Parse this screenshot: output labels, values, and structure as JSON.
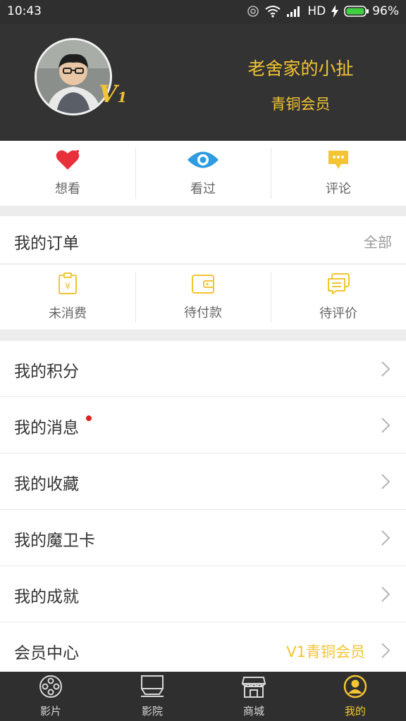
{
  "status_bar": {
    "time": "10:43",
    "network": "HD",
    "battery": "96%"
  },
  "profile": {
    "username": "老舍家的小扯",
    "level": "青铜会员",
    "badge_letter": "V",
    "badge_number": "1"
  },
  "quick_actions": [
    {
      "label": "想看",
      "icon": "heart-icon"
    },
    {
      "label": "看过",
      "icon": "eye-icon"
    },
    {
      "label": "评论",
      "icon": "comment-icon"
    }
  ],
  "orders": {
    "title": "我的订单",
    "all_label": "全部",
    "items": [
      {
        "label": "未消费",
        "icon": "ticket-icon"
      },
      {
        "label": "待付款",
        "icon": "wallet-icon"
      },
      {
        "label": "待评价",
        "icon": "review-icon"
      }
    ]
  },
  "menu": [
    {
      "label": "我的积分"
    },
    {
      "label": "我的消息",
      "has_new": true
    },
    {
      "label": "我的收藏"
    },
    {
      "label": "我的魔卫卡"
    },
    {
      "label": "我的成就"
    },
    {
      "label": "会员中心",
      "value": "V1青铜会员"
    }
  ],
  "tabs": [
    {
      "label": "影片",
      "icon": "film-reel-icon"
    },
    {
      "label": "影院",
      "icon": "cinema-screen-icon"
    },
    {
      "label": "商城",
      "icon": "store-icon"
    },
    {
      "label": "我的",
      "icon": "user-icon",
      "active": true
    }
  ],
  "colors": {
    "accent": "#f3c433",
    "dark_bg": "#333333",
    "heart": "#e8303a",
    "eye": "#2f9be0",
    "badge_dot": "#e02020"
  }
}
